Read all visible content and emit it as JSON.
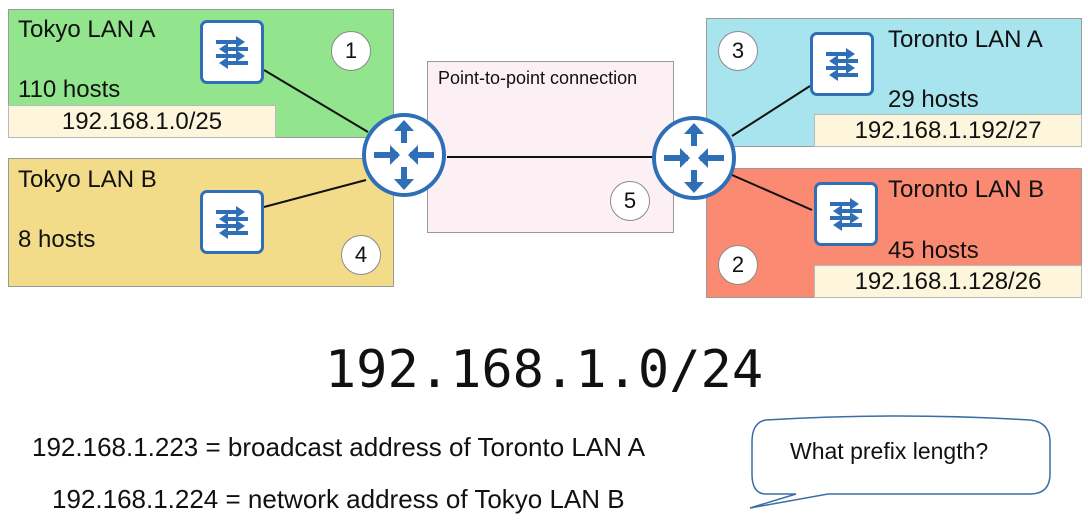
{
  "lans": {
    "tokyo_a": {
      "title": "Tokyo LAN A",
      "hosts": "110 hosts",
      "subnet": "192.168.1.0/25",
      "number": "1",
      "color": "#92e58d"
    },
    "tokyo_b": {
      "title": "Tokyo LAN B",
      "hosts": "8 hosts",
      "subnet": "",
      "number": "4",
      "color": "#f2dc8a"
    },
    "toronto_a": {
      "title": "Toronto LAN A",
      "hosts": "29 hosts",
      "subnet": "192.168.1.192/27",
      "number": "3",
      "color": "#a8e4ee"
    },
    "toronto_b": {
      "title": "Toronto LAN B",
      "hosts": "45 hosts",
      "subnet": "192.168.1.128/26",
      "number": "2",
      "color": "#fb8a73"
    }
  },
  "p2p": {
    "label": "Point-to-point connection",
    "number": "5"
  },
  "network": "192.168.1.0/24",
  "notes": [
    "192.168.1.223 = broadcast address of Toronto LAN A",
    "192.168.1.224 = network address of Tokyo LAN B"
  ],
  "callout": "What prefix length?",
  "colors": {
    "device_blue": "#2f6fb7",
    "subnet_box": "#fdf6dc",
    "p2p_fill": "#fdf0f5"
  },
  "icons": {
    "switch": "switch-icon",
    "router": "router-icon"
  }
}
